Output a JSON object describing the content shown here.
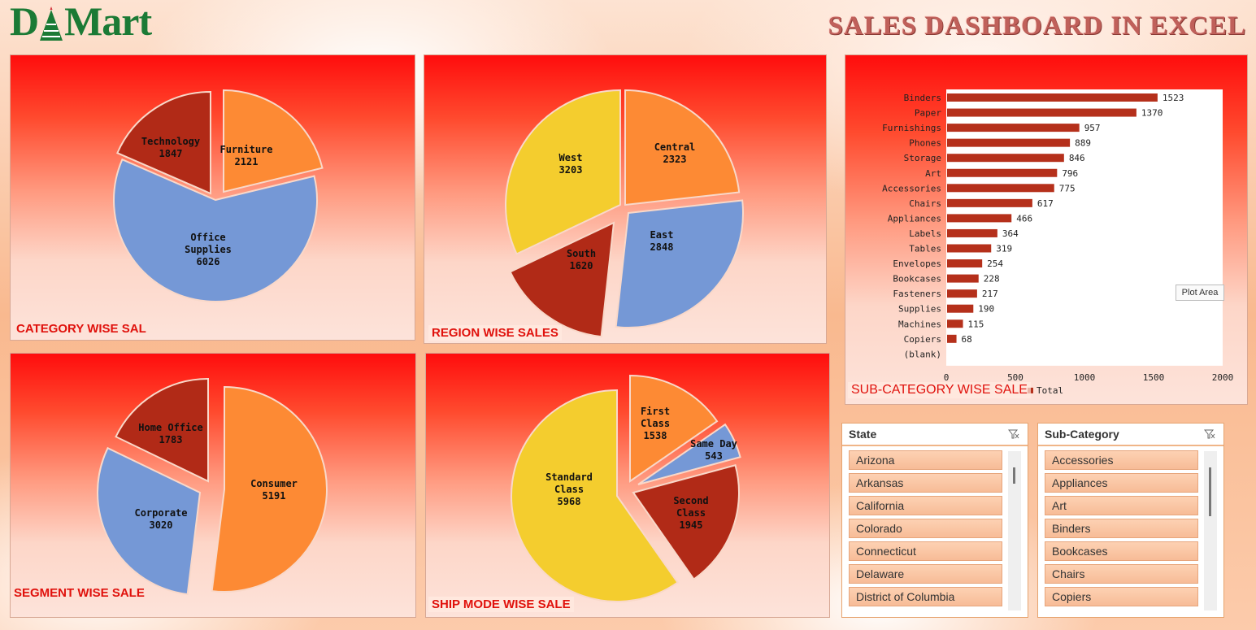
{
  "header": {
    "logo_text": "DMart",
    "title": "SALES DASHBOARD IN EXCEL"
  },
  "colors": {
    "orange": "#fd8a34",
    "blue": "#7598d6",
    "darkred": "#b12a17",
    "yellow": "#f4cd2e",
    "bar": "#b5301b",
    "title_red": "#e0110c"
  },
  "panels": {
    "category": {
      "title": "CATEGORY WISE SAL"
    },
    "region": {
      "title": "REGION WISE SALES"
    },
    "segment": {
      "title": "SEGMENT WISE SALE"
    },
    "shipmode": {
      "title": "SHIP MODE WISE SALE"
    },
    "subcategory": {
      "title": "SUB-CATEGORY WISE SALE",
      "legend": "Total",
      "plot_area_tip": "Plot Area"
    }
  },
  "chart_data": [
    {
      "type": "pie",
      "title": "CATEGORY WISE SAL",
      "slices": [
        {
          "label": "Furniture",
          "value": 2121,
          "color": "#fd8a34"
        },
        {
          "label": "Office Supplies",
          "value": 6026,
          "color": "#7598d6"
        },
        {
          "label": "Technology",
          "value": 1847,
          "color": "#b12a17"
        }
      ]
    },
    {
      "type": "pie",
      "title": "REGION WISE SALES",
      "slices": [
        {
          "label": "Central",
          "value": 2323,
          "color": "#fd8a34"
        },
        {
          "label": "East",
          "value": 2848,
          "color": "#7598d6"
        },
        {
          "label": "South",
          "value": 1620,
          "color": "#b12a17"
        },
        {
          "label": "West",
          "value": 3203,
          "color": "#f4cd2e"
        }
      ]
    },
    {
      "type": "pie",
      "title": "SEGMENT WISE SALE",
      "slices": [
        {
          "label": "Consumer",
          "value": 5191,
          "color": "#fd8a34"
        },
        {
          "label": "Corporate",
          "value": 3020,
          "color": "#7598d6"
        },
        {
          "label": "Home Office",
          "value": 1783,
          "color": "#b12a17"
        }
      ]
    },
    {
      "type": "pie",
      "title": "SHIP MODE WISE SALE",
      "slices": [
        {
          "label": "First Class",
          "value": 1538,
          "color": "#fd8a34"
        },
        {
          "label": "Same Day",
          "value": 543,
          "color": "#7598d6"
        },
        {
          "label": "Second Class",
          "value": 1945,
          "color": "#b12a17"
        },
        {
          "label": "Standard Class",
          "value": 5968,
          "color": "#f4cd2e"
        }
      ]
    },
    {
      "type": "bar",
      "orientation": "horizontal",
      "title": "SUB-CATEGORY WISE SALE",
      "categories": [
        "Binders",
        "Paper",
        "Furnishings",
        "Phones",
        "Storage",
        "Art",
        "Accessories",
        "Chairs",
        "Appliances",
        "Labels",
        "Tables",
        "Envelopes",
        "Bookcases",
        "Fasteners",
        "Supplies",
        "Machines",
        "Copiers",
        "(blank)"
      ],
      "series": [
        {
          "name": "Total",
          "values": [
            1523,
            1370,
            957,
            889,
            846,
            796,
            775,
            617,
            466,
            364,
            319,
            254,
            228,
            217,
            190,
            115,
            68,
            null
          ]
        }
      ],
      "xlim": [
        0,
        2000
      ],
      "xticks": [
        0,
        500,
        1000,
        1500,
        2000
      ],
      "legend_position": "bottom"
    }
  ],
  "slicers": {
    "state": {
      "title": "State",
      "items": [
        "Arizona",
        "Arkansas",
        "California",
        "Colorado",
        "Connecticut",
        "Delaware",
        "District of Columbia"
      ]
    },
    "subcategory": {
      "title": "Sub-Category",
      "items": [
        "Accessories",
        "Appliances",
        "Art",
        "Binders",
        "Bookcases",
        "Chairs",
        "Copiers"
      ]
    }
  }
}
